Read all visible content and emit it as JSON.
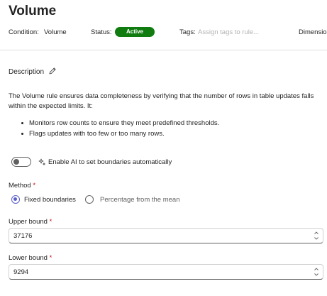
{
  "header": {
    "title": "Volume",
    "condition_label": "Condition:",
    "condition_value": "Volume",
    "status_label": "Status:",
    "status_value": "Active",
    "tags_label": "Tags:",
    "tags_placeholder": "Assign tags to rule...",
    "dimension_label": "Dimensio"
  },
  "description": {
    "heading": "Description",
    "text": "The Volume rule ensures data completeness by verifying that the number of rows in table updates falls within the expected limits. It:",
    "bullets": [
      "Monitors row counts to ensure they meet predefined thresholds.",
      "Flags updates with too few or too many rows."
    ]
  },
  "ai_toggle": {
    "label": "Enable AI to set boundaries automatically",
    "on": false
  },
  "method": {
    "label": "Method",
    "required_mark": "*",
    "options": [
      "Fixed boundaries",
      "Percentage from the mean"
    ],
    "selected": "Fixed boundaries"
  },
  "upper_bound": {
    "label": "Upper bound",
    "required_mark": "*",
    "value": "37176"
  },
  "lower_bound": {
    "label": "Lower bound",
    "required_mark": "*",
    "value": "9294"
  },
  "colors": {
    "status_active": "#107c10",
    "accent": "#5b5fc7",
    "required": "#c50f1f"
  }
}
